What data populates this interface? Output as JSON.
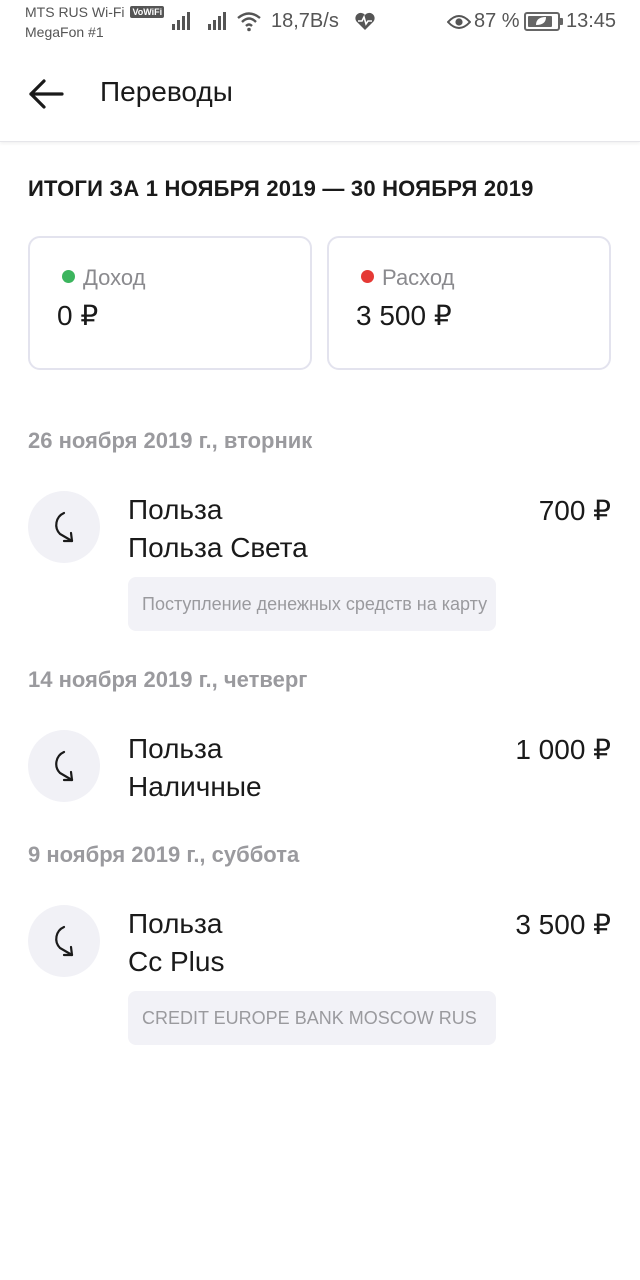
{
  "status_bar": {
    "carrier_primary": "MTS RUS Wi-Fi",
    "vowifi_badge": "VoWiFi",
    "carrier_secondary": "MegaFon #1",
    "network_speed": "18,7B/s",
    "battery_percent": "87 %",
    "battery_level": 0.87,
    "time": "13:45"
  },
  "header": {
    "title": "Переводы",
    "back_icon": "arrow-left-icon"
  },
  "summary": {
    "heading": "ИТОГИ ЗА 1 НОЯБРЯ 2019 — 30 НОЯБРЯ 2019",
    "income": {
      "label": "Доход",
      "value": "0 ₽",
      "dot_color": "#3cb55e"
    },
    "expense": {
      "label": "Расход",
      "value": "3 500 ₽",
      "dot_color": "#e53935"
    }
  },
  "groups": [
    {
      "date": "26 ноября 2019 г., вторник",
      "transactions": [
        {
          "icon": "transfer-arrow-icon",
          "title": "Польза",
          "subtitle": "Польза Света",
          "amount": "700 ₽",
          "note": "Поступление денежных средств на карту"
        }
      ]
    },
    {
      "date": "14 ноября 2019 г., четверг",
      "transactions": [
        {
          "icon": "transfer-arrow-icon",
          "title": "Польза",
          "subtitle": "Наличные",
          "amount": "1 000 ₽"
        }
      ]
    },
    {
      "date": "9 ноября 2019 г., суббота",
      "transactions": [
        {
          "icon": "transfer-arrow-icon",
          "title": "Польза",
          "subtitle": "Cc Plus",
          "amount": "3 500 ₽",
          "note": "CREDIT EUROPE BANK MOSCOW RUS"
        }
      ]
    }
  ]
}
